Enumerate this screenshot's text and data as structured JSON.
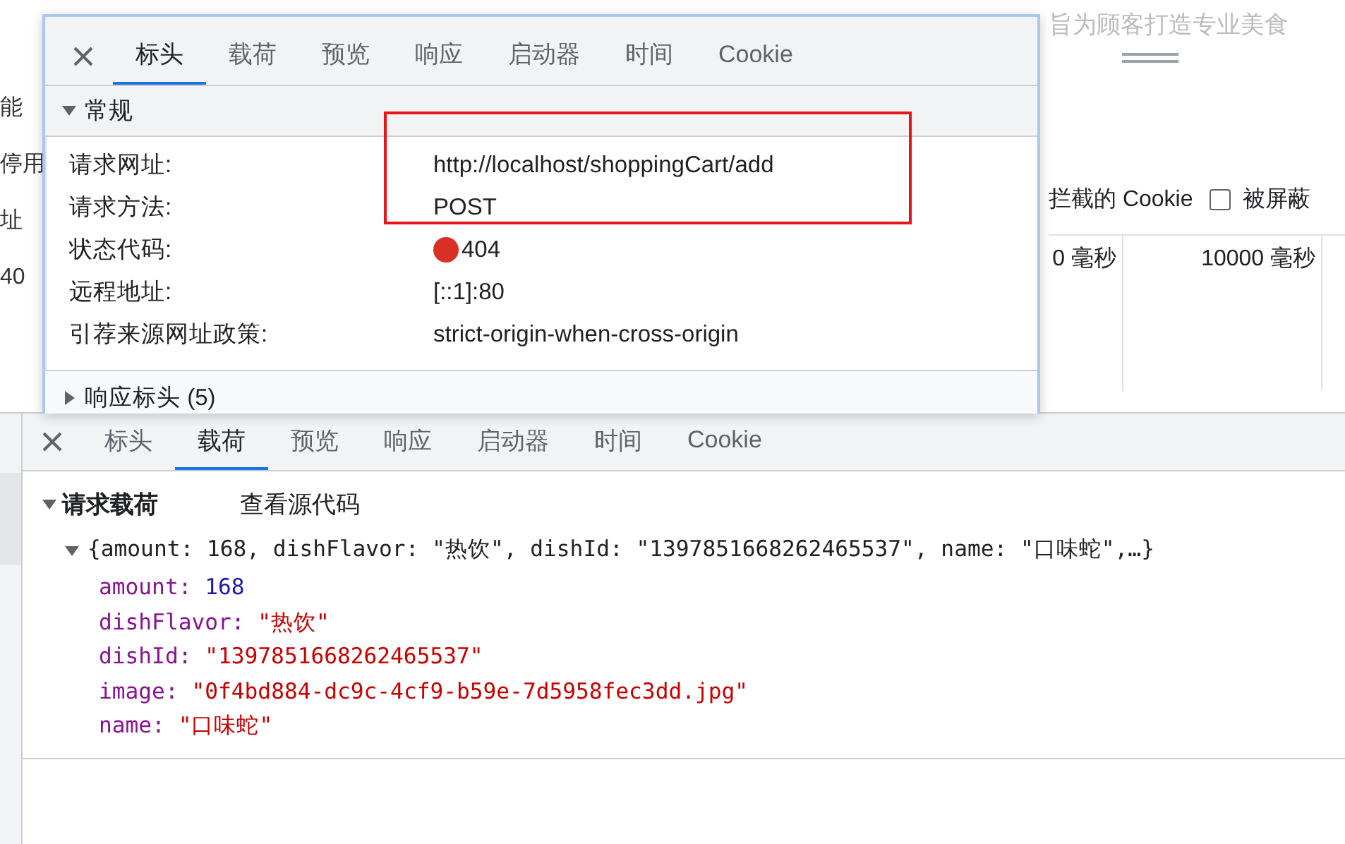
{
  "background": {
    "banner_text": "旨为顾客打造专业美食",
    "left_fragments": [
      "能",
      "停用",
      "址",
      "40"
    ],
    "blocked_cookies": {
      "label": "拦截的 Cookie"
    },
    "blocked_requests": {
      "label": "被屏蔽",
      "checked": false
    },
    "timings": [
      "0 毫秒",
      "10000 毫秒"
    ]
  },
  "popup": {
    "tabs": [
      {
        "label": "标头",
        "selected": true
      },
      {
        "label": "载荷",
        "selected": false
      },
      {
        "label": "预览",
        "selected": false
      },
      {
        "label": "响应",
        "selected": false
      },
      {
        "label": "启动器",
        "selected": false
      },
      {
        "label": "时间",
        "selected": false
      },
      {
        "label": "Cookie",
        "selected": false
      }
    ],
    "general": {
      "title": "常规",
      "expanded": true,
      "rows": [
        {
          "label": "请求网址:",
          "value": "http://localhost/shoppingCart/add",
          "highlighted": true
        },
        {
          "label": "请求方法:",
          "value": "POST",
          "highlighted": true
        },
        {
          "label": "状态代码:",
          "value": "404",
          "highlighted": false,
          "color": "#d93025"
        },
        {
          "label": "远程地址:",
          "value": "[::1]:80",
          "highlighted": false
        },
        {
          "label": "引荐来源网址政策:",
          "value": "strict-origin-when-cross-origin",
          "highlighted": false
        }
      ]
    },
    "response_headers": {
      "title": "响应标头 (5)",
      "expanded": false
    }
  },
  "payload_panel": {
    "tabs": [
      {
        "label": "标头",
        "selected": false
      },
      {
        "label": "载荷",
        "selected": true
      },
      {
        "label": "预览",
        "selected": false
      },
      {
        "label": "响应",
        "selected": false
      },
      {
        "label": "启动器",
        "selected": false
      },
      {
        "label": "时间",
        "selected": false
      },
      {
        "label": "Cookie",
        "selected": false
      }
    ],
    "section": {
      "title": "请求载荷",
      "expanded": true,
      "view_source": "查看源代码"
    },
    "object": {
      "summary": "{amount: 168, dishFlavor: \"热饮\", dishId: \"1397851668262465537\", name: \"口味蛇\",…}",
      "expanded": true,
      "properties": [
        {
          "key": "amount:",
          "value": "168",
          "kind": "number"
        },
        {
          "key": "dishFlavor:",
          "value": "\"热饮\"",
          "kind": "string"
        },
        {
          "key": "dishId:",
          "value": "\"1397851668262465537\"",
          "kind": "string"
        },
        {
          "key": "image:",
          "value": "\"0f4bd884-dc9c-4cf9-b59e-7d5958fec3dd.jpg\"",
          "kind": "string"
        },
        {
          "key": "name:",
          "value": "\"口味蛇\"",
          "kind": "string"
        }
      ]
    }
  }
}
